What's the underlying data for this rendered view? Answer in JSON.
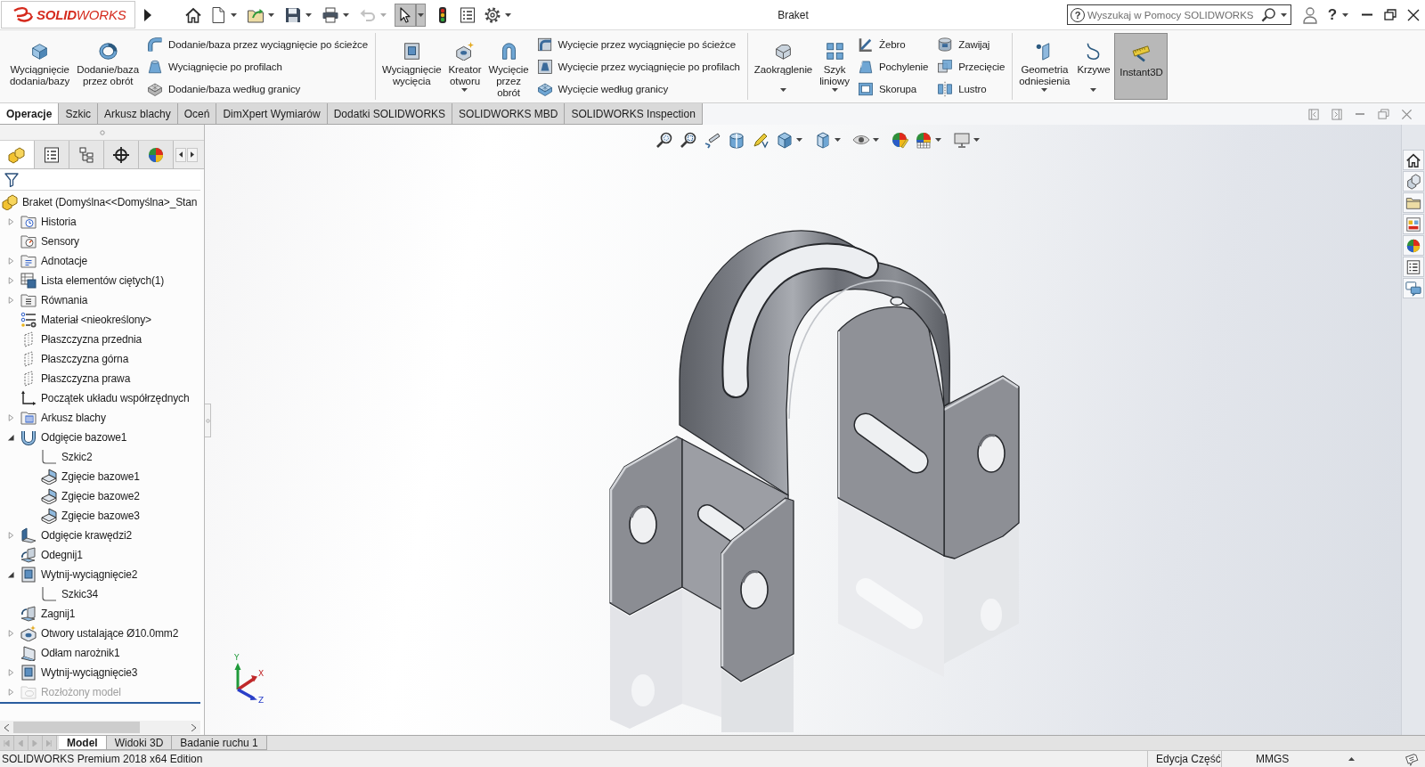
{
  "title_bar": {
    "logo": "**SOLID**WORKS",
    "quick_access": [
      {
        "kind": "home",
        "dropdown": false,
        "pressed": false,
        "disabled": false
      },
      {
        "kind": "new",
        "dropdown": true,
        "pressed": false,
        "disabled": false
      },
      {
        "kind": "open",
        "dropdown": true,
        "pressed": false,
        "disabled": false
      },
      {
        "kind": "save",
        "dropdown": true,
        "pressed": false,
        "disabled": false
      },
      {
        "kind": "print",
        "dropdown": true,
        "pressed": false,
        "disabled": false
      },
      {
        "kind": "undo",
        "dropdown": true,
        "pressed": false,
        "disabled": true
      },
      {
        "kind": "select",
        "dropdown": true,
        "pressed": true,
        "disabled": false
      },
      {
        "kind": "rebuild",
        "dropdown": false,
        "pressed": false,
        "disabled": false
      },
      {
        "kind": "file-properties",
        "dropdown": false,
        "pressed": false,
        "disabled": false
      },
      {
        "kind": "options",
        "dropdown": true,
        "pressed": false,
        "disabled": false
      }
    ],
    "title": "Braket",
    "search": {
      "help_mark": "?",
      "placeholder": "Wyszukaj w Pomocy SOLIDWORKS"
    },
    "help": "?"
  },
  "ribbon": {
    "groups": [
      {
        "columns": [
          [
            {
              "label": "Wyciągnięcie dodania/bazy",
              "kind": "extrude",
              "dropdown": false,
              "pressed": false
            }
          ],
          [
            {
              "label": "Dodanie/baza przez obrót",
              "kind": "revolve",
              "dropdown": false,
              "pressed": false
            }
          ],
          [
            {
              "label": "Dodanie/baza przez wyciągnięcie po ścieżce",
              "kind": "sweep",
              "dropdown": false,
              "pressed": false
            },
            {
              "label": "Wyciągnięcie po profilach",
              "kind": "loft",
              "dropdown": false,
              "pressed": false
            },
            {
              "label": "Dodanie/baza według granicy",
              "kind": "boundary",
              "dropdown": false,
              "pressed": false
            }
          ]
        ]
      },
      {
        "columns": [
          [
            {
              "label": "Wyciągnięcie wycięcia",
              "kind": "cut-extrude",
              "dropdown": false,
              "pressed": false
            }
          ],
          [
            {
              "label": "Kreator otworu",
              "kind": "hole-wizard",
              "dropdown": true,
              "pressed": false
            }
          ],
          [
            {
              "label": "Wycięcie przez obrót",
              "kind": "cut-revolve",
              "dropdown": false,
              "pressed": false
            }
          ],
          [
            {
              "label": "Wycięcie przez wyciągnięcie po ścieżce",
              "kind": "cut-sweep",
              "dropdown": false,
              "pressed": false
            },
            {
              "label": "Wycięcie przez wyciągnięcie po profilach",
              "kind": "cut-loft",
              "dropdown": false,
              "pressed": false
            },
            {
              "label": "Wycięcie według granicy",
              "kind": "cut-boundary",
              "dropdown": false,
              "pressed": false
            }
          ]
        ]
      },
      {
        "columns": [
          [
            {
              "label": "Zaokrąglenie",
              "kind": "fillet",
              "dropdown": true,
              "pressed": false
            }
          ],
          [
            {
              "label": "Szyk liniowy",
              "kind": "linear-pattern",
              "dropdown": true,
              "pressed": false
            }
          ],
          [
            {
              "label": "Żebro",
              "kind": "rib",
              "dropdown": false,
              "pressed": false
            },
            {
              "label": "Pochylenie",
              "kind": "draft",
              "dropdown": false,
              "pressed": false
            },
            {
              "label": "Skorupa",
              "kind": "shell",
              "dropdown": false,
              "pressed": false
            }
          ],
          [
            {
              "label": "Zawijaj",
              "kind": "wrap",
              "dropdown": false,
              "pressed": false
            },
            {
              "label": "Przecięcie",
              "kind": "intersect",
              "dropdown": false,
              "pressed": false
            },
            {
              "label": "Lustro",
              "kind": "mirror",
              "dropdown": false,
              "pressed": false
            }
          ]
        ]
      },
      {
        "columns": [
          [
            {
              "label": "Geometria odniesienia",
              "kind": "reference-geometry",
              "dropdown": true,
              "pressed": false
            }
          ],
          [
            {
              "label": "Krzywe",
              "kind": "curves",
              "dropdown": true,
              "pressed": false
            }
          ],
          [
            {
              "label": "Instant3D",
              "kind": "instant3d",
              "dropdown": false,
              "pressed": true
            }
          ]
        ]
      }
    ],
    "tabs": [
      {
        "label": "Operacje",
        "selected": true
      },
      {
        "label": "Szkic",
        "selected": false
      },
      {
        "label": "Arkusz blachy",
        "selected": false
      },
      {
        "label": "Oceń",
        "selected": false
      },
      {
        "label": "DimXpert Wymiarów",
        "selected": false
      },
      {
        "label": "Dodatki SOLIDWORKS",
        "selected": false
      },
      {
        "label": "SOLIDWORKS MBD",
        "selected": false
      },
      {
        "label": "SOLIDWORKS Inspection",
        "selected": false
      }
    ]
  },
  "feature_tree": {
    "panel_tabs": [
      {
        "kind": "feature-manager",
        "selected": true
      },
      {
        "kind": "property-manager",
        "selected": false
      },
      {
        "kind": "configuration-manager",
        "selected": false
      },
      {
        "kind": "dimxpert-manager",
        "selected": false
      },
      {
        "kind": "display-manager",
        "selected": false
      }
    ],
    "root": {
      "label": "Braket (Domyślna<<Domyślna>_Stan",
      "kind": "part",
      "children": [
        {
          "label": "Historia",
          "kind": "history",
          "expanded": false,
          "disabled": false
        },
        {
          "label": "Sensory",
          "kind": "sensors",
          "disabled": false
        },
        {
          "label": "Adnotacje",
          "kind": "annotations",
          "expanded": false,
          "disabled": false
        },
        {
          "label": "Lista elementów ciętych(1)",
          "kind": "cut-list",
          "expanded": false,
          "disabled": false
        },
        {
          "label": "Równania",
          "kind": "equations",
          "expanded": false,
          "disabled": false
        },
        {
          "label": "Materiał <nieokreślony>",
          "kind": "material",
          "disabled": false
        },
        {
          "label": "Płaszczyzna przednia",
          "kind": "plane",
          "disabled": false
        },
        {
          "label": "Płaszczyzna górna",
          "kind": "plane",
          "disabled": false
        },
        {
          "label": "Płaszczyzna prawa",
          "kind": "plane",
          "disabled": false
        },
        {
          "label": "Początek układu współrzędnych",
          "kind": "origin",
          "disabled": false
        },
        {
          "label": "Arkusz blachy",
          "kind": "sheet-metal",
          "expanded": false,
          "disabled": false
        },
        {
          "label": "Odgięcie bazowe1",
          "kind": "base-flange",
          "expanded": true,
          "disabled": false,
          "children": [
            {
              "label": "Szkic2",
              "kind": "sketch",
              "disabled": false
            },
            {
              "label": "Zgięcie bazowe1",
              "kind": "bend",
              "disabled": false
            },
            {
              "label": "Zgięcie bazowe2",
              "kind": "bend",
              "disabled": false
            },
            {
              "label": "Zgięcie bazowe3",
              "kind": "bend",
              "disabled": false
            }
          ]
        },
        {
          "label": "Odgięcie krawędzi2",
          "kind": "edge-flange",
          "expanded": false,
          "disabled": false
        },
        {
          "label": "Odegnij1",
          "kind": "unfold",
          "disabled": false
        },
        {
          "label": "Wytnij-wyciągnięcie2",
          "kind": "cut",
          "expanded": true,
          "disabled": false,
          "children": [
            {
              "label": "Szkic34",
              "kind": "sketch",
              "disabled": false
            }
          ]
        },
        {
          "label": "Zagnij1",
          "kind": "fold",
          "disabled": false
        },
        {
          "label": "Otwory ustalające Ø10.0mm2",
          "kind": "hole",
          "expanded": false,
          "disabled": false
        },
        {
          "label": "Odłam narożnik1",
          "kind": "corner",
          "disabled": false
        },
        {
          "label": "Wytnij-wyciągnięcie3",
          "kind": "cut",
          "expanded": false,
          "disabled": false
        },
        {
          "label": "Rozłożony model",
          "kind": "flat-pattern",
          "expanded": false,
          "disabled": true
        }
      ]
    }
  },
  "viewport": {
    "heads_up_toolbar": [
      {
        "kind": "zoom-fit",
        "dropdown": false
      },
      {
        "kind": "zoom-area",
        "dropdown": false
      },
      {
        "kind": "previous-view",
        "dropdown": false
      },
      {
        "kind": "section-view",
        "dropdown": false
      },
      {
        "kind": "dynamic-annotation",
        "dropdown": false
      },
      {
        "kind": "view-orientation",
        "dropdown": true
      },
      {
        "kind": "display-style",
        "dropdown": true
      },
      {
        "kind": "hide-show",
        "dropdown": true
      },
      {
        "kind": "edit-appearance",
        "dropdown": false
      },
      {
        "kind": "apply-scene",
        "dropdown": true
      },
      {
        "kind": "view-settings",
        "dropdown": true
      }
    ],
    "triad": {
      "x": "X",
      "y": "Y",
      "z": "Z"
    }
  },
  "task_pane": [
    {
      "kind": "home"
    },
    {
      "kind": "library"
    },
    {
      "kind": "explorer"
    },
    {
      "kind": "view-palette"
    },
    {
      "kind": "appearances"
    },
    {
      "kind": "custom-properties"
    },
    {
      "kind": "forum"
    }
  ],
  "bottom_tabs": [
    {
      "label": "Model",
      "selected": true
    },
    {
      "label": "Widoki 3D",
      "selected": false
    },
    {
      "label": "Badanie ruchu 1",
      "selected": false
    }
  ],
  "status_bar": {
    "product": "SOLIDWORKS Premium 2018 x64 Edition",
    "mode": "Edycja Część",
    "units": "MMGS"
  }
}
